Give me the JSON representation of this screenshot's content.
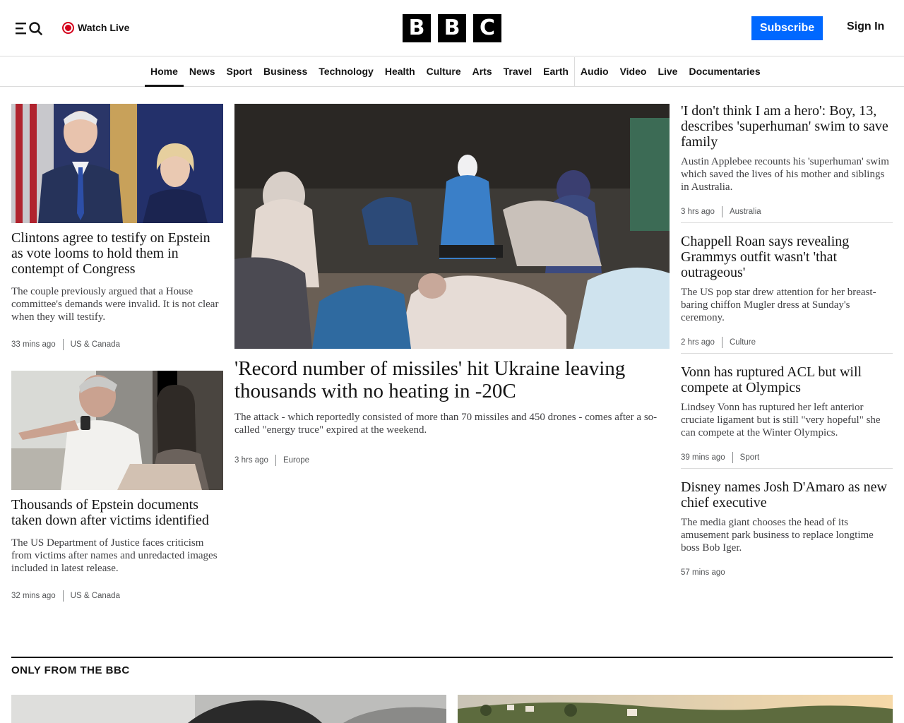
{
  "header": {
    "watch_live": "Watch Live",
    "logo_letters": [
      "B",
      "B",
      "C"
    ],
    "subscribe": "Subscribe",
    "sign_in": "Sign In"
  },
  "nav": {
    "items": [
      "Home",
      "News",
      "Sport",
      "Business",
      "Technology",
      "Health",
      "Culture",
      "Arts",
      "Travel",
      "Earth",
      "Audio",
      "Video",
      "Live",
      "Documentaries"
    ],
    "active": "Home"
  },
  "left": [
    {
      "headline": "Clintons agree to testify on Epstein as vote looms to hold them in contempt of Congress",
      "summary": "The couple previously argued that a House committee's demands were invalid. It is not clear when they will testify.",
      "time": "33 mins ago",
      "tag": "US & Canada"
    },
    {
      "headline": "Thousands of Epstein documents taken down after victims identified",
      "summary": "The US Department of Justice faces criticism from victims after names and unredacted images included in latest release.",
      "time": "32 mins ago",
      "tag": "US & Canada"
    }
  ],
  "lead": {
    "headline": "'Record number of missiles' hit Ukraine leaving thousands with no heating in -20C",
    "summary": "The attack - which reportedly consisted of more than 70 missiles and 450 drones - comes after a so-called \"energy truce\" expired at the weekend.",
    "time": "3 hrs ago",
    "tag": "Europe"
  },
  "right": [
    {
      "headline": "'I don't think I am a hero': Boy, 13, describes 'superhuman' swim to save family",
      "summary": "Austin Applebee recounts his 'superhuman' swim which saved the lives of his mother and siblings in Australia.",
      "time": "3 hrs ago",
      "tag": "Australia"
    },
    {
      "headline": "Chappell Roan says revealing Grammys outfit wasn't 'that outrageous'",
      "summary": "The US pop star drew attention for her breast-baring chiffon Mugler dress at Sunday's ceremony.",
      "time": "2 hrs ago",
      "tag": "Culture"
    },
    {
      "headline": "Vonn has ruptured ACL but will compete at Olympics",
      "summary": "Lindsey Vonn has ruptured her left anterior cruciate ligament but is still \"very hopeful\" she can compete at the Winter Olympics.",
      "time": "39 mins ago",
      "tag": "Sport"
    },
    {
      "headline": "Disney names Josh D'Amaro as new chief executive",
      "summary": "The media giant chooses the head of its amusement park business to replace longtime boss Bob Iger.",
      "time": "57 mins ago",
      "tag": ""
    }
  ],
  "section": {
    "title": "ONLY FROM THE BBC"
  },
  "colors": {
    "accent": "#0068ff",
    "live_red": "#d4001b",
    "text": "#141414",
    "border": "#dcdcdc"
  },
  "icons": {
    "menu": "menu-icon",
    "search": "search-icon",
    "live": "live-dot-icon"
  }
}
